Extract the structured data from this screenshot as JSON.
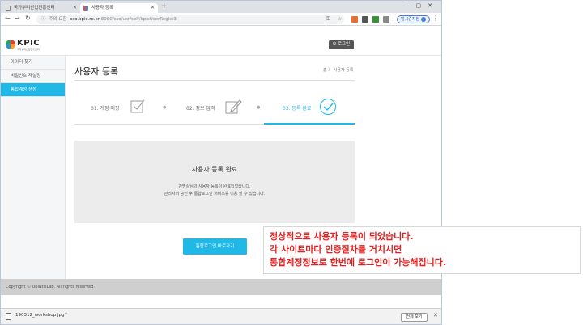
{
  "browser": {
    "tabs": [
      {
        "title": "국가뿌리산업진흥센터"
      },
      {
        "title": "사용자 등록"
      }
    ],
    "url": {
      "security_label": "주의 요함",
      "host": "sso.kpic.re.kr",
      "path": ":8080/sso/usr/self/kpicUserRegist3"
    },
    "guest_label": "일시중지됨"
  },
  "site": {
    "logo_name": "KPIC",
    "logo_sub": "국가뿌리산업진흥센터",
    "login_button": "로그인"
  },
  "sidebar": {
    "items": [
      {
        "label": "아이디 찾기",
        "active": false
      },
      {
        "label": "비밀번호 재설정",
        "active": false
      },
      {
        "label": "통합계정 생성",
        "active": true
      }
    ]
  },
  "main": {
    "title": "사용자 등록",
    "breadcrumb": {
      "home": "홈",
      "current": "사용자 등록"
    },
    "steps": [
      {
        "label": "01. 계정 매핑"
      },
      {
        "label": "02. 정보 입력"
      },
      {
        "label": "03. 등록 완료"
      }
    ],
    "done": {
      "title": "사용자 등록 완료",
      "line1": "강명실님의 사용자 등록이 완료되었습니다.",
      "line2": "관리자의 승인 후 통합로그인 서비스를 이용 할 수 있습니다."
    },
    "go_button": "통합로그인 바로가기"
  },
  "footer": {
    "copyright": "Copyright © UbiNtisLab. All rights reserved."
  },
  "downloads": {
    "file_name": "190312_workshop.jpg",
    "show_all": "전체 보기"
  },
  "annotation": {
    "line1": "정상적으로 사용자 등록이 되었습니다.",
    "line2": "각 사이트마다 인증절차를 거치시면",
    "line3": "통합계정정보로 한번에 로그인이 가능해집니다."
  },
  "colors": {
    "accent": "#1fb8e7",
    "annotation": "#e02020"
  }
}
